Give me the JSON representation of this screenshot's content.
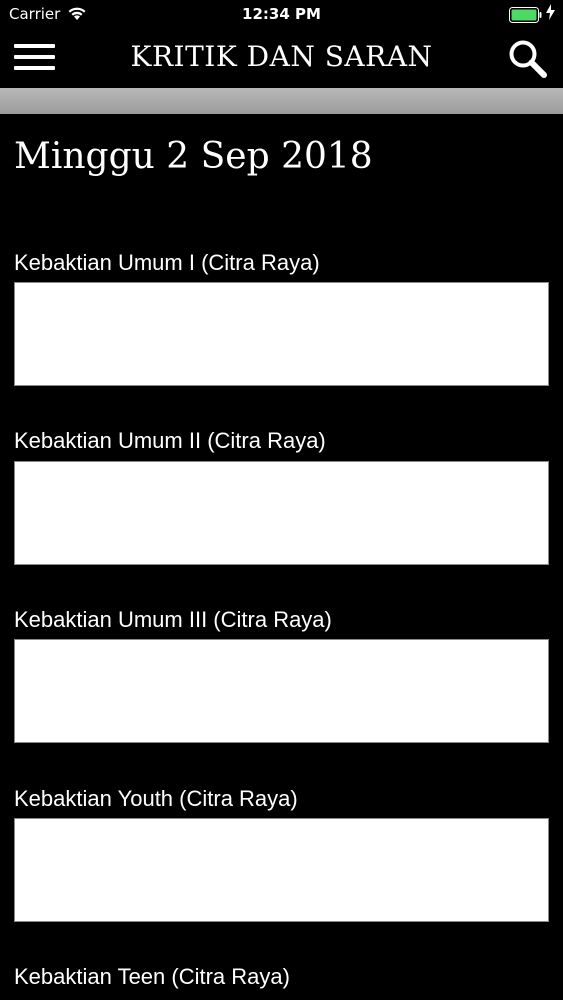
{
  "status_bar": {
    "carrier": "Carrier",
    "time": "12:34 PM"
  },
  "nav": {
    "title": "KRITIK DAN SARAN",
    "menu_icon": "hamburger-menu-icon",
    "search_icon": "search-icon"
  },
  "page": {
    "title": "Minggu 2 Sep 2018"
  },
  "fields": [
    {
      "label": "Kebaktian Umum I (Citra Raya)",
      "value": ""
    },
    {
      "label": "Kebaktian Umum II (Citra Raya)",
      "value": ""
    },
    {
      "label": "Kebaktian Umum III (Citra Raya)",
      "value": ""
    },
    {
      "label": "Kebaktian Youth (Citra Raya)",
      "value": ""
    },
    {
      "label": "Kebaktian Teen (Citra Raya)",
      "value": ""
    }
  ],
  "colors": {
    "background": "#000000",
    "field_background": "#ffffff",
    "battery": "#4cd964"
  }
}
